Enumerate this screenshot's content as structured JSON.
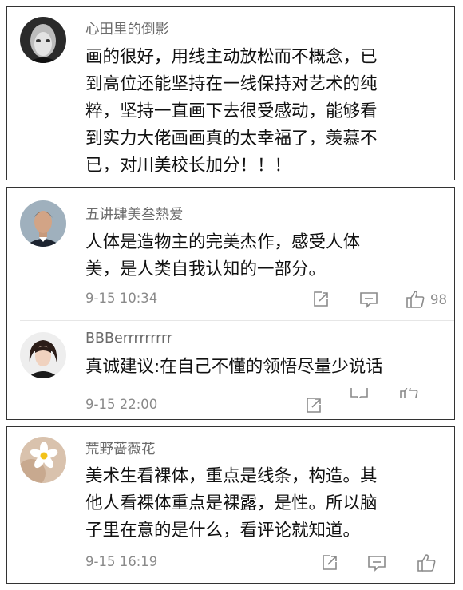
{
  "comments": [
    {
      "username": "心田里的倒影",
      "lines": [
        "画的很好，用线主动放松而不概念，已",
        "到高位还能坚持在一线保持对艺术的纯",
        "粹，坚持一直画下去很受感动，能够看",
        "到实力大佬画画真的太幸福了，羡慕不",
        "已，对川美校长加分！！！"
      ]
    },
    {
      "username": "五讲肆美叁熱爱",
      "lines": [
        "人体是造物主的完美杰作，感受人体",
        "美，是人类自我认知的一部分。"
      ],
      "timestamp": "9-15 10:34",
      "like_count": "98"
    },
    {
      "username": "BBBerrrrrrrrr",
      "lines": [
        "真诚建议:在自己不懂的领悟尽量少说话"
      ],
      "timestamp": "9-15 22:00"
    },
    {
      "username": "荒野蔷薇花",
      "lines": [
        "美术生看裸体，重点是线条，构造。其",
        "他人看裸体重点是裸露，是性。所以脑",
        "子里在意的是什么，看评论就知道。"
      ],
      "timestamp": "9-15 16:19"
    }
  ],
  "icons": {
    "share": "share-icon",
    "comment": "comment-icon",
    "like": "like-icon"
  },
  "colors": {
    "card_border": "#333333",
    "username": "#6b6b6b",
    "meta": "#8a8a8a",
    "text": "#111111"
  }
}
